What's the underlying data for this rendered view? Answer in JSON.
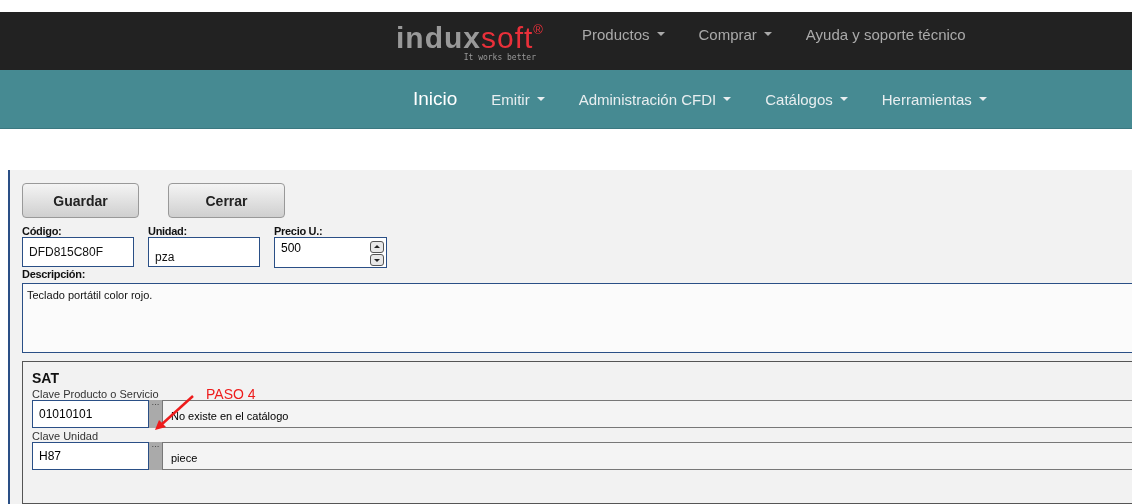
{
  "logo": {
    "part1": "indux",
    "part2": "soft",
    "mark": "®",
    "tagline": "It works better"
  },
  "top_nav": [
    {
      "label": "Productos",
      "dropdown": true
    },
    {
      "label": "Comprar",
      "dropdown": true
    },
    {
      "label": "Ayuda y soporte técnico",
      "dropdown": false
    }
  ],
  "main_nav": [
    {
      "label": "Inicio",
      "dropdown": false,
      "selected": true
    },
    {
      "label": "Emitir",
      "dropdown": true,
      "selected": false
    },
    {
      "label": "Administración CFDI",
      "dropdown": true,
      "selected": false
    },
    {
      "label": "Catálogos",
      "dropdown": true,
      "selected": false
    },
    {
      "label": "Herramientas",
      "dropdown": true,
      "selected": false
    }
  ],
  "buttons": [
    "Guardar",
    "Cerrar"
  ],
  "fields": [
    {
      "label": "Código:",
      "value": "DFD815C80F",
      "kind": "text"
    },
    {
      "label": "Unidad:",
      "value": "pza",
      "kind": "text"
    },
    {
      "label": "Precio U.:",
      "value": "500",
      "kind": "spinner"
    }
  ],
  "description": {
    "label": "Descripción:",
    "value": "Teclado portátil color rojo."
  },
  "sat": {
    "title": "SAT",
    "rows": [
      {
        "label": "Clave Producto o Servicio",
        "code": "01010101",
        "button": "···",
        "name": "No existe en el catálogo"
      },
      {
        "label": "Clave Unidad",
        "code": "H87",
        "button": "···",
        "name": "piece"
      }
    ]
  },
  "annotation": {
    "text": "PASO 4"
  }
}
